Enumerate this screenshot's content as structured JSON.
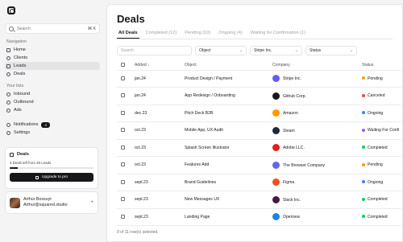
{
  "sidebar": {
    "search_placeholder": "Search",
    "search_shortcut": "⌘ K",
    "navigation_label": "Navigation",
    "nav": [
      {
        "label": "Home",
        "icon": "home-icon"
      },
      {
        "label": "Clients",
        "icon": "clients-icon"
      },
      {
        "label": "Leads",
        "icon": "leads-icon"
      },
      {
        "label": "Deals",
        "icon": "deals-icon"
      }
    ],
    "lists_label": "Your lists",
    "lists": [
      {
        "label": "Inbound",
        "icon": "inbound-icon"
      },
      {
        "label": "Outbound",
        "icon": "outbound-icon"
      },
      {
        "label": "Ads",
        "icon": "ads-icon"
      }
    ],
    "notifications_label": "Notifications",
    "notifications_count": "4",
    "settings_label": "Settings",
    "promo": {
      "title": "Deals",
      "text": "3 Deals left from 30 Leads",
      "progress": 0.1,
      "button": "Upgrade to pro"
    },
    "user": {
      "name": "Arthur Bossuyt",
      "email": "Arthur@squared.studio"
    }
  },
  "main": {
    "title": "Deals",
    "tabs": [
      {
        "label": "All Deals"
      },
      {
        "label": "Completed (12)"
      },
      {
        "label": "Pending (10)"
      },
      {
        "label": "Ongoing (4)"
      },
      {
        "label": "Waiting for Confirmation (1)"
      }
    ],
    "filters": {
      "search_placeholder": "Search",
      "object": "Object",
      "company": "Stripe Inc.",
      "status": "Status"
    },
    "columns": {
      "added": "Added",
      "object": "Object",
      "company": "Company",
      "status": "Status"
    },
    "rows": [
      {
        "added": "jan.24",
        "object": "Product Design / Payment",
        "company": "Stripe Inc.",
        "logo_color": "#635bff",
        "status": "Pending",
        "status_color": "#f59e0b"
      },
      {
        "added": "jan.24",
        "object": "App Redesign / Onboarding",
        "company": "Github Corp.",
        "logo_color": "#18181b",
        "status": "Canceled",
        "status_color": "#ef4444"
      },
      {
        "added": "dec.23",
        "object": "Pitch Deck B2B",
        "company": "Amazon",
        "logo_color": "#ff9900",
        "status": "Ongoing",
        "status_color": "#3b82f6"
      },
      {
        "added": "oct.23",
        "object": "Mobile App, UX Audit",
        "company": "Steam",
        "logo_color": "#1b2838",
        "status": "Waiting For Confi",
        "status_color": "#a855f7"
      },
      {
        "added": "oct.23",
        "object": "Splash Screen Illustrator",
        "company": "Adobe LLC.",
        "logo_color": "#e11d1d",
        "status": "Completed",
        "status_color": "#22c55e"
      },
      {
        "added": "oct.23",
        "object": "Features Add",
        "company": "The Browser Company",
        "logo_color": "#6366f1",
        "status": "Pending",
        "status_color": "#f59e0b"
      },
      {
        "added": "sept.23",
        "object": "Brand Guidelines",
        "company": "Figma",
        "logo_color": "#f24e1e",
        "status": "Ongoing",
        "status_color": "#3b82f6"
      },
      {
        "added": "sept.23",
        "object": "New Messages UX",
        "company": "Slack Inc.",
        "logo_color": "#4a154b",
        "status": "Completed",
        "status_color": "#22c55e"
      },
      {
        "added": "sept.23",
        "object": "Landing Page",
        "company": "Opensea",
        "logo_color": "#2081e2",
        "status": "Completed",
        "status_color": "#22c55e"
      }
    ],
    "footer": "0 of 11 row(s) selected."
  }
}
